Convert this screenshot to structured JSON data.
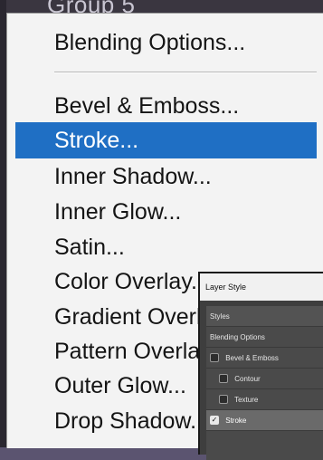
{
  "top_partial_text": "Group 5",
  "menu": {
    "items": [
      {
        "label": "Blending Options...",
        "selected": false
      },
      {
        "label": "Bevel & Emboss...",
        "selected": false
      },
      {
        "label": "Stroke...",
        "selected": true
      },
      {
        "label": "Inner Shadow...",
        "selected": false
      },
      {
        "label": "Inner Glow...",
        "selected": false
      },
      {
        "label": "Satin...",
        "selected": false
      },
      {
        "label": "Color Overlay...",
        "selected": false
      },
      {
        "label": "Gradient Overlay...",
        "selected": false
      },
      {
        "label": "Pattern Overlay...",
        "selected": false
      },
      {
        "label": "Outer Glow...",
        "selected": false
      },
      {
        "label": "Drop Shadow...",
        "selected": false
      }
    ],
    "selected_color": "#1f6fc4"
  },
  "dialog": {
    "title": "Layer Style",
    "rows": [
      {
        "label": "Styles",
        "checkbox": false,
        "checked": false
      },
      {
        "label": "Blending Options",
        "checkbox": false,
        "checked": false
      },
      {
        "label": "Bevel & Emboss",
        "checkbox": true,
        "checked": false
      },
      {
        "label": "Contour",
        "checkbox": true,
        "checked": false
      },
      {
        "label": "Texture",
        "checkbox": true,
        "checked": false
      },
      {
        "label": "Stroke",
        "checkbox": true,
        "checked": true
      }
    ]
  }
}
